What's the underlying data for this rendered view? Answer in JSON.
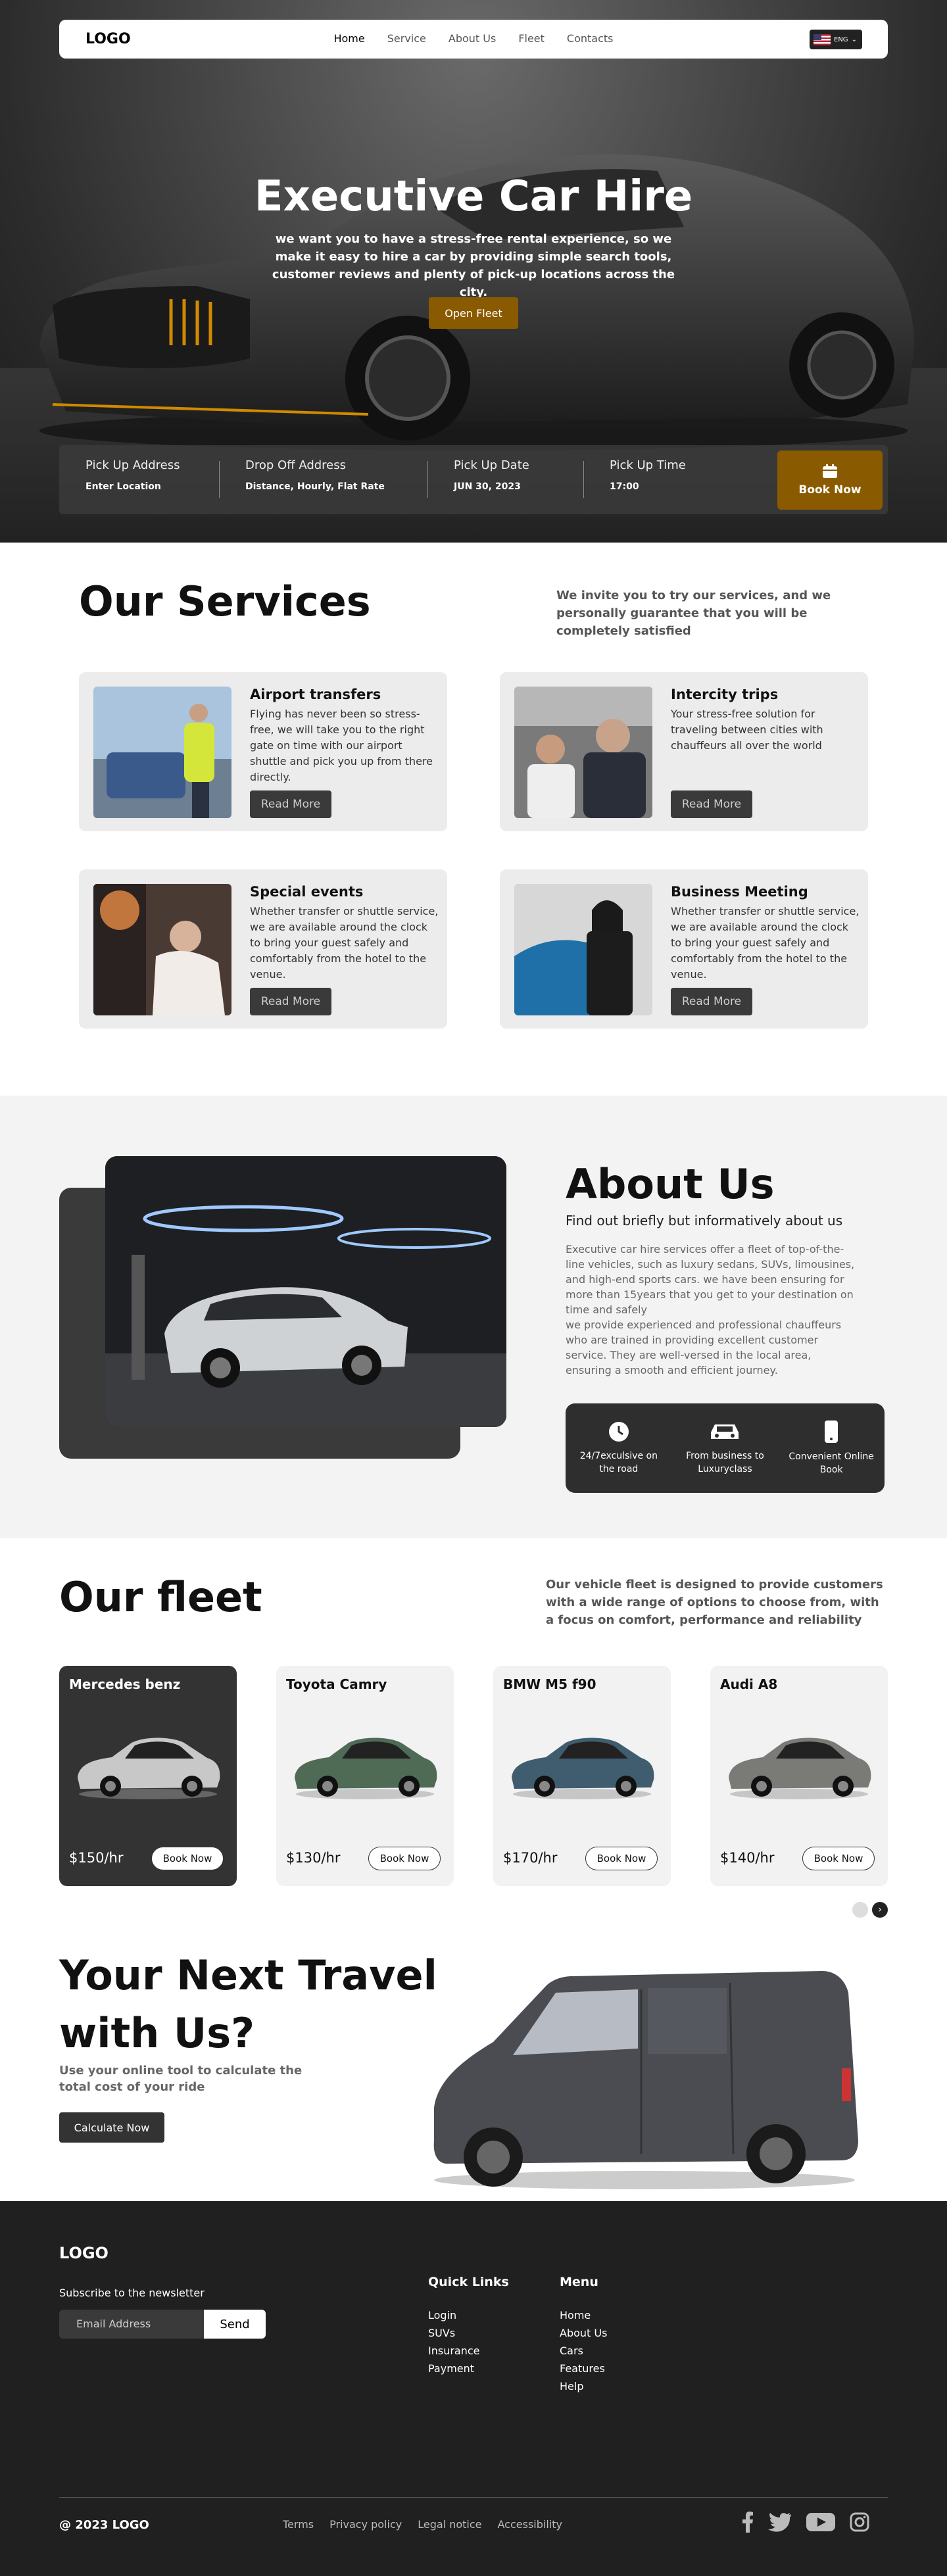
{
  "nav": {
    "logo": "LOGO",
    "links": [
      "Home",
      "Service",
      "About Us",
      "Fleet",
      "Contacts"
    ],
    "language": "ENG"
  },
  "hero": {
    "title": "Executive Car Hire",
    "subtitle": "we want you to have a stress-free rental experience, so we make it easy to hire a car by providing simple search tools, customer reviews and plenty of pick-up locations across the city.",
    "cta": "Open Fleet"
  },
  "booking": {
    "fields": [
      {
        "label": "Pick Up Address",
        "value": "Enter Location"
      },
      {
        "label": "Drop Off Address",
        "value": "Distance, Hourly, Flat Rate"
      },
      {
        "label": "Pick Up Date",
        "value": "JUN 30, 2023"
      },
      {
        "label": "Pick Up Time",
        "value": "17:00"
      }
    ],
    "button": "Book Now"
  },
  "services": {
    "title": "Our Services",
    "description": "We invite you to try our services, and we personally guarantee that you will be completely satisfied",
    "read_more": "Read More",
    "items": [
      {
        "title": "Airport transfers",
        "text": "Flying has never been so stress-free, we will take you to the right gate on time with our airport shuttle and pick you up from there directly."
      },
      {
        "title": "Intercity trips",
        "text": "Your stress-free solution for traveling between cities with chauffeurs all over the world"
      },
      {
        "title": "Special events",
        "text": "Whether transfer or shuttle service, we are available around the clock to bring your guest safely and comfortably from the hotel to the venue."
      },
      {
        "title": "Business Meeting",
        "text": "Whether transfer or shuttle service, we are available around the clock to bring your guest safely and comfortably from the hotel to the venue."
      }
    ]
  },
  "about": {
    "title": "About Us",
    "subtitle": "Find out briefly  but informatively about us",
    "text": "Executive car hire services offer a fleet of top-of-the-line vehicles, such as luxury sedans, SUVs, limousines, and high-end sports cars. we have been ensuring for more than 15years that you get to your destination on time and safely\nwe provide experienced and professional chauffeurs who are trained in providing excellent customer service. They are well-versed in the local area, ensuring a smooth and efficient journey.",
    "features": [
      {
        "icon": "clock-icon",
        "label": "24/7exculsive on the road"
      },
      {
        "icon": "car-icon",
        "label": "From business to Luxuryclass"
      },
      {
        "icon": "phone-icon",
        "label": "Convenient Online Book"
      }
    ]
  },
  "fleet": {
    "title": "Our fleet",
    "description": "Our vehicle fleet is designed to provide customers with a wide range of options to choose from, with a focus on comfort, performance and  reliability",
    "book_label": "Book Now",
    "cars": [
      {
        "name": "Mercedes benz",
        "price": "$150/hr",
        "color": "#c8c8c8"
      },
      {
        "name": "Toyota Camry",
        "price": "$130/hr",
        "color": "#4f6b55"
      },
      {
        "name": "BMW M5 f90",
        "price": "$170/hr",
        "color": "#3f5d6e"
      },
      {
        "name": "Audi A8",
        "price": "$140/hr",
        "color": "#7a7a76"
      }
    ]
  },
  "travel": {
    "title": "Your Next Travel with Us?",
    "description": "Use your online tool to calculate the total cost of your ride",
    "cta": "Calculate Now"
  },
  "footer": {
    "logo": "LOGO",
    "newsletter_label": "Subscribe to the newsletter",
    "email_placeholder": "Email Address",
    "send": "Send",
    "quick_links_title": "Quick Links",
    "quick_links": [
      "Login",
      "SUVs",
      "Insurance",
      "Payment"
    ],
    "menu_title": "Menu",
    "menu": [
      "Home",
      "About Us",
      "Cars",
      "Features",
      "Help"
    ],
    "copyright": "@ 2023 LOGO",
    "legal": [
      "Terms",
      "Privacy policy",
      "Legal notice",
      "Accessibility"
    ],
    "social": [
      "facebook-icon",
      "twitter-icon",
      "youtube-icon",
      "instagram-icon"
    ]
  },
  "colors": {
    "accent": "#8a5a00",
    "dark": "#333333",
    "footer": "#202020"
  }
}
